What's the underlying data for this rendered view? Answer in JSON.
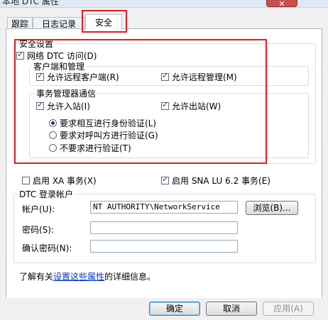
{
  "window": {
    "title": "本地 DTC 属性",
    "close_glyph": "✕"
  },
  "tabs": [
    {
      "label": "跟踪"
    },
    {
      "label": "日志记录"
    },
    {
      "label": "安全"
    }
  ],
  "security": {
    "group_label": "安全设置",
    "network_dtc_access": {
      "label": "网络 DTC 访问(D)",
      "checked": true
    },
    "client_admin": {
      "group_label": "客户端和管理",
      "allow_remote_clients": {
        "label": "允许远程客户端(R)",
        "checked": true
      },
      "allow_remote_admin": {
        "label": "允许远程管理(M)",
        "checked": true
      }
    },
    "tm_comm": {
      "group_label": "事务管理器通信",
      "allow_inbound": {
        "label": "允许入站(I)",
        "checked": true
      },
      "allow_outbound": {
        "label": "允许出站(W)",
        "checked": true
      },
      "auth_options": [
        {
          "label": "要求相互进行身份验证(L)",
          "selected": true
        },
        {
          "label": "要求对呼叫方进行验证(G)",
          "selected": false
        },
        {
          "label": "不要求进行验证(T)",
          "selected": false
        }
      ]
    }
  },
  "enable_xa": {
    "label": "启用 XA 事务(X)",
    "checked": false
  },
  "enable_sna": {
    "label": "启用 SNA LU 6.2 事务(E)",
    "checked": true
  },
  "logon": {
    "group_label": "DTC 登录帐户",
    "account_label": "帐户(U):",
    "account_value": "NT AUTHORITY\\NetworkService",
    "browse_label": "浏览(B)...",
    "password_label": "密码(S):",
    "password_value": "",
    "confirm_label": "确认密码(N):",
    "confirm_value": ""
  },
  "info": {
    "prefix": "了解有关",
    "link1": "设置这些属性",
    "suffix": "的详细信息。"
  },
  "buttons": {
    "ok": "确定",
    "cancel": "取消",
    "apply": "应用(A)"
  },
  "annotation_color": "#e02020"
}
